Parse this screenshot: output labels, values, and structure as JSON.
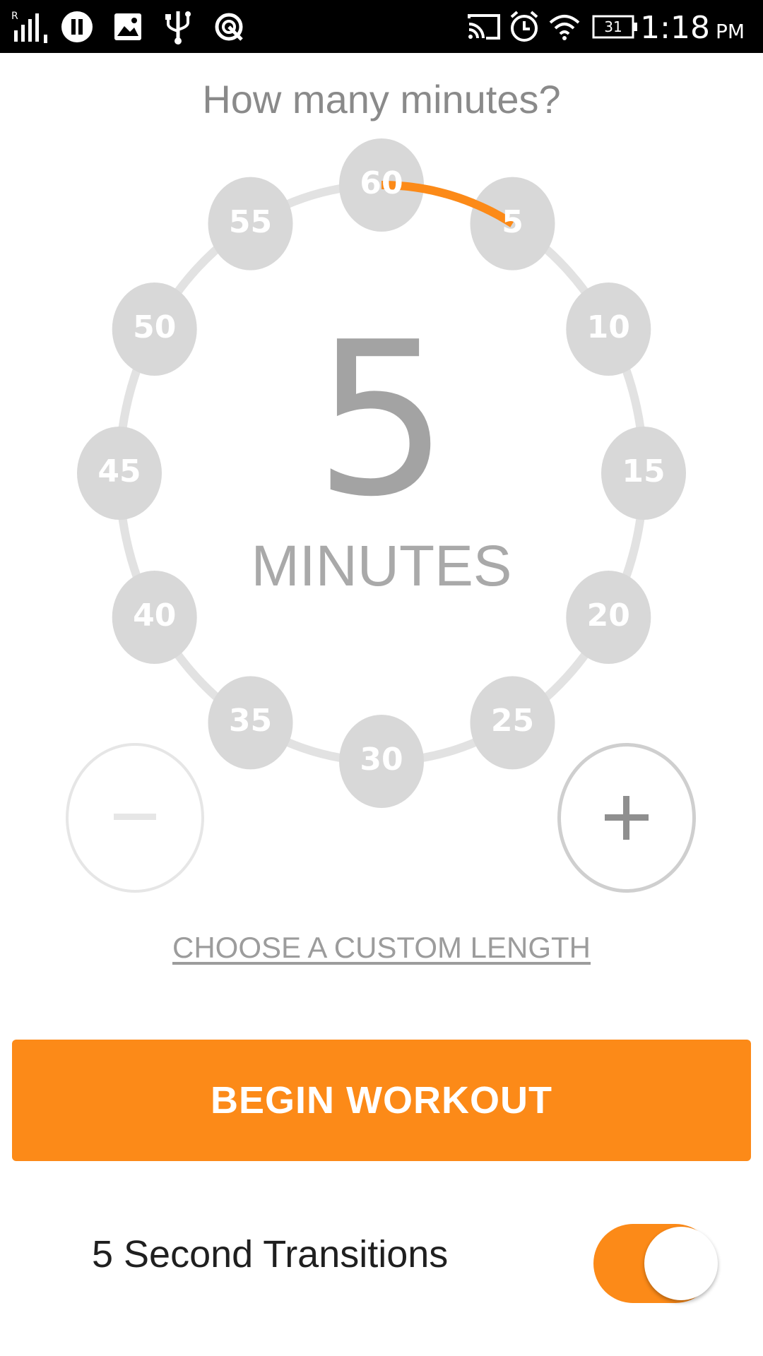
{
  "status_bar": {
    "time": "1:18",
    "ampm": "PM",
    "battery_level": "31",
    "icons": [
      "roaming-signal-icon",
      "pause-icon",
      "image-icon",
      "usb-icon",
      "sync-icon",
      "cast-icon",
      "alarm-icon",
      "wifi-icon",
      "battery-icon"
    ]
  },
  "heading": "How many minutes?",
  "dial": {
    "selected_value": "5",
    "unit_label": "MINUTES",
    "options": [
      "60",
      "5",
      "10",
      "15",
      "20",
      "25",
      "30",
      "35",
      "40",
      "45",
      "50",
      "55"
    ],
    "progress_fraction": 0.0833,
    "accent_color": "#fc8a18",
    "node_color": "#d8d8d8",
    "ring_color": "#e2e2e2"
  },
  "controls": {
    "decrease_icon": "minus-icon",
    "increase_icon": "plus-icon"
  },
  "custom_link": "CHOOSE A CUSTOM LENGTH",
  "begin_button": "BEGIN WORKOUT",
  "transitions": {
    "label": "5 Second Transitions",
    "enabled": true
  }
}
